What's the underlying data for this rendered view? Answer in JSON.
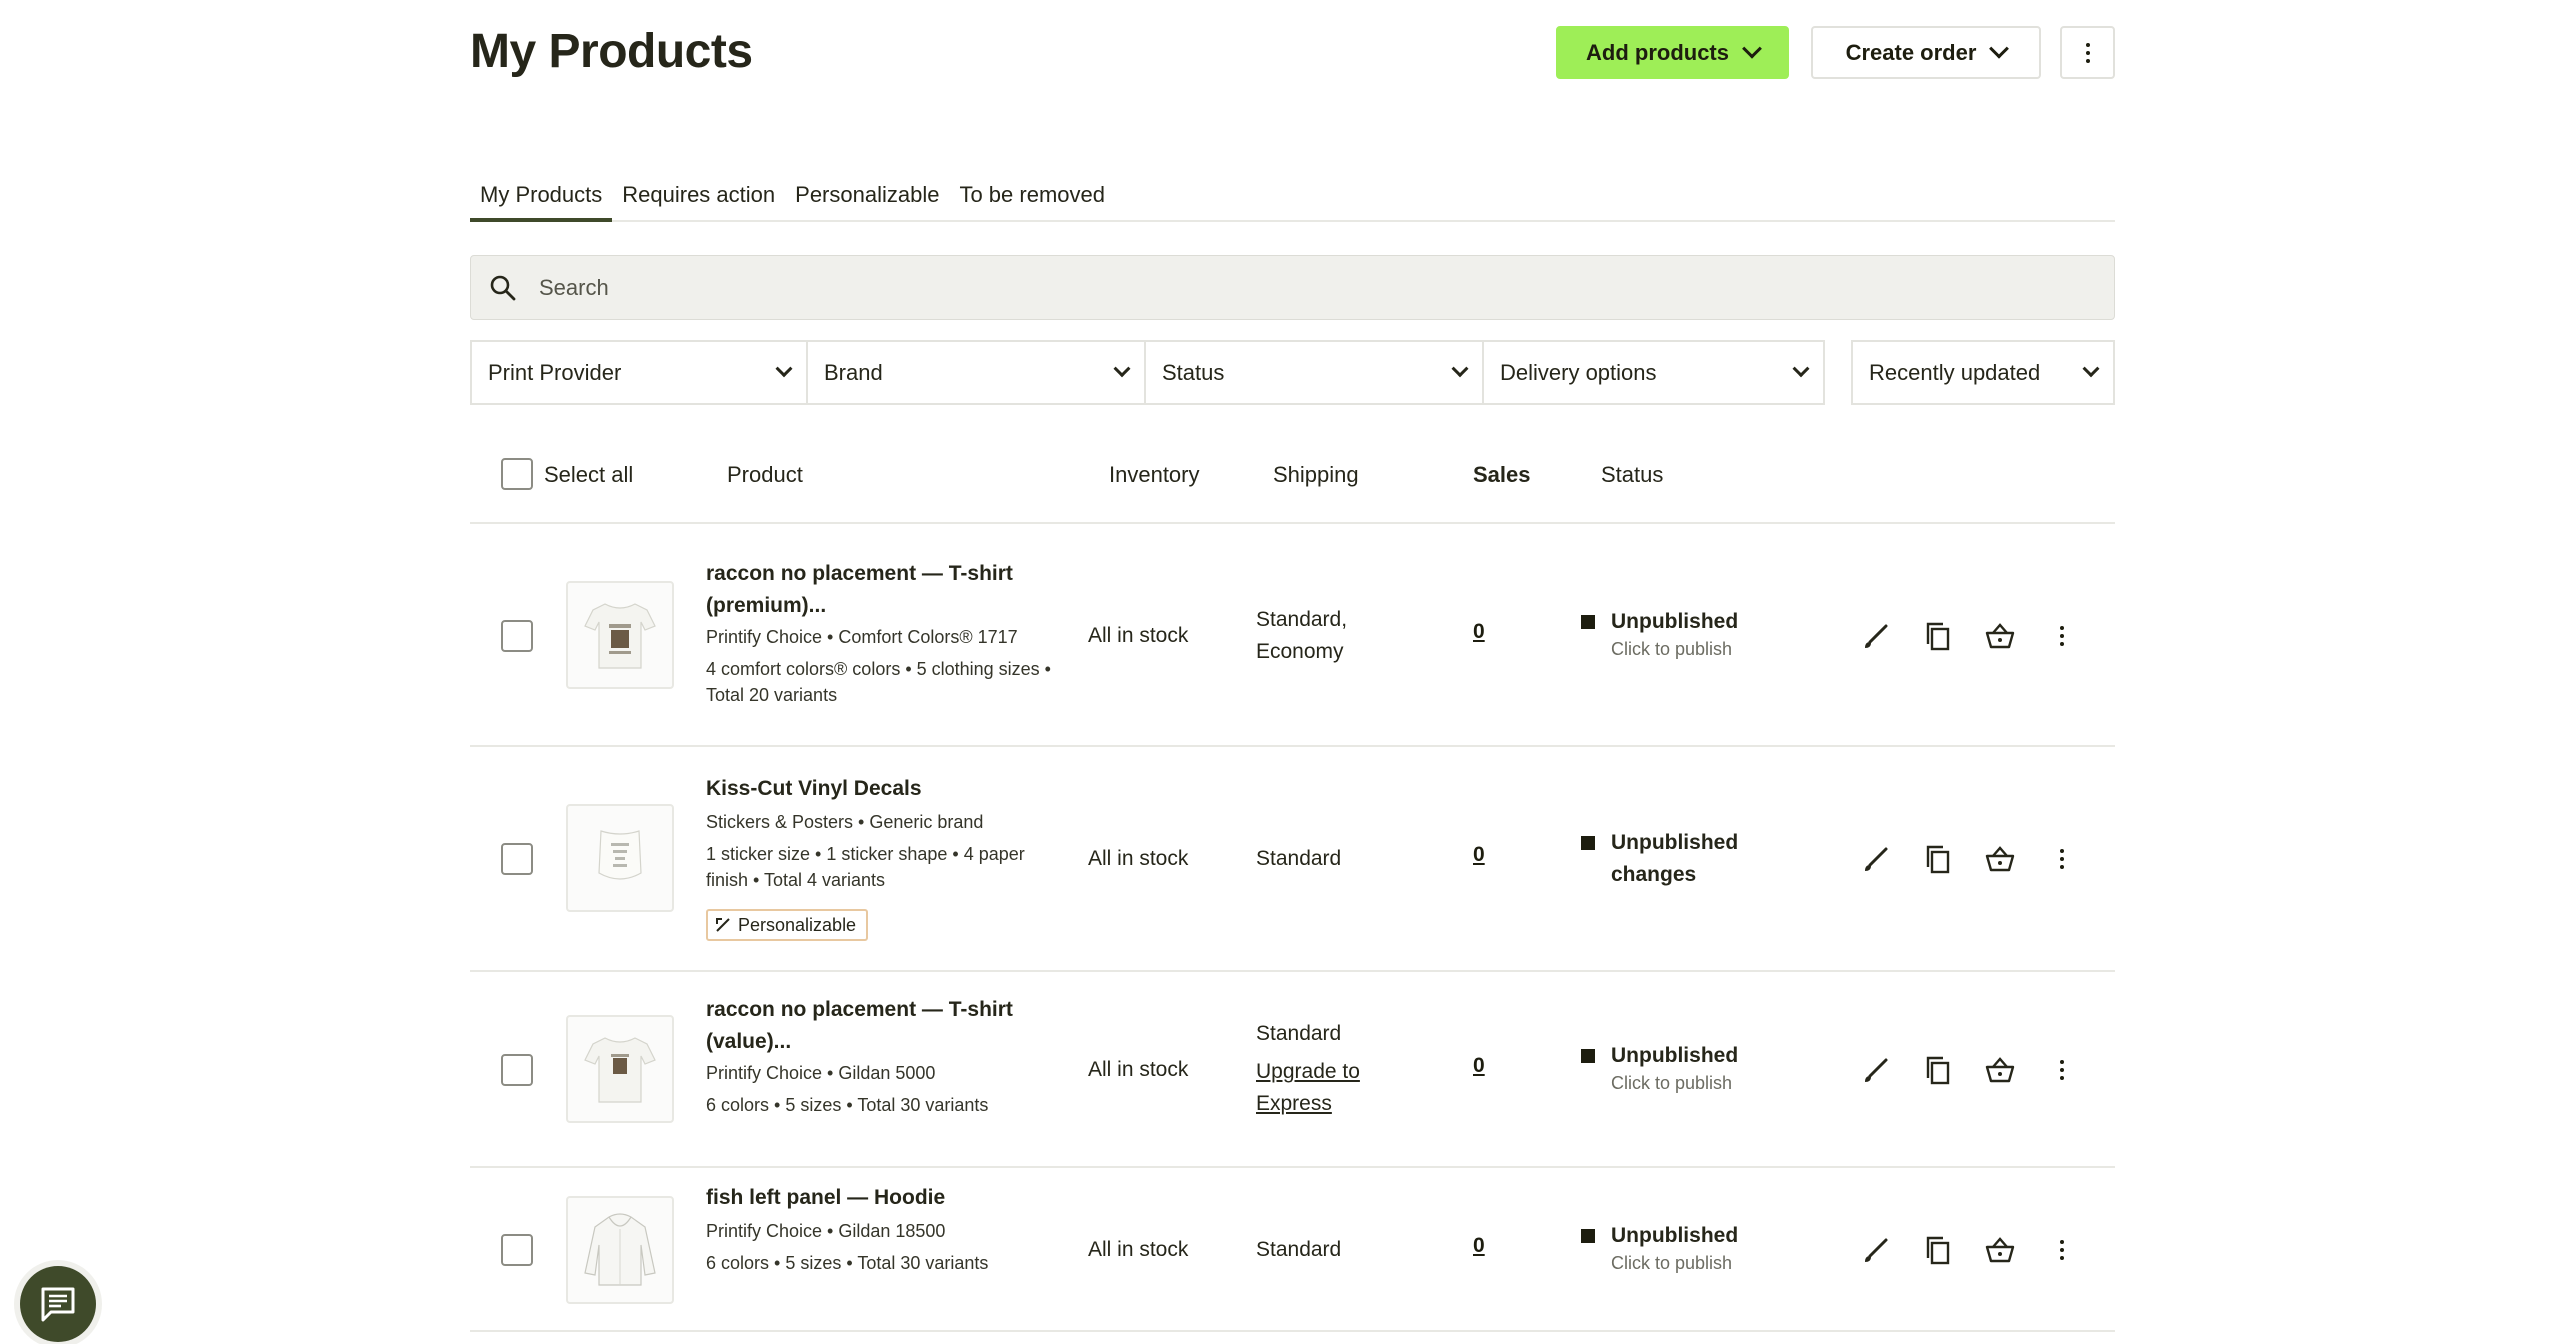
{
  "header": {
    "title": "My Products",
    "add_products_label": "Add products",
    "create_order_label": "Create order"
  },
  "tabs": [
    {
      "label": "My Products",
      "active": true
    },
    {
      "label": "Requires action"
    },
    {
      "label": "Personalizable"
    },
    {
      "label": "To be removed"
    }
  ],
  "search": {
    "placeholder": "Search"
  },
  "filters": {
    "print_provider": "Print Provider",
    "brand": "Brand",
    "status": "Status",
    "delivery": "Delivery options",
    "sort": "Recently updated"
  },
  "table": {
    "select_all": "Select all",
    "columns": {
      "product": "Product",
      "inventory": "Inventory",
      "shipping": "Shipping",
      "sales": "Sales",
      "status": "Status"
    }
  },
  "rows": [
    {
      "name": "raccon no placement — T-shirt (premium)...",
      "provider": "Printify Choice • Comfort Colors® 1717",
      "variants": "4 comfort colors® colors • 5 clothing sizes • Total 20 variants",
      "inventory": "All in stock",
      "shipping": "Standard, Economy",
      "sales": "0",
      "status": "Unpublished",
      "status_sub": "Click to publish"
    },
    {
      "name": "Kiss-Cut Vinyl Decals",
      "provider": "Stickers & Posters • Generic brand",
      "variants": "1 sticker size • 1 sticker shape • 4 paper finish • Total 4 variants",
      "badge": "Personalizable",
      "inventory": "All in stock",
      "shipping": "Standard",
      "sales": "0",
      "status": "Unpublished changes"
    },
    {
      "name": "raccon no placement — T-shirt (value)...",
      "provider": "Printify Choice • Gildan 5000",
      "variants": "6 colors • 5 sizes • Total 30 variants",
      "inventory": "All in stock",
      "shipping": "Standard",
      "shipping_link": "Upgrade to Express",
      "sales": "0",
      "status": "Unpublished",
      "status_sub": "Click to publish"
    },
    {
      "name": "fish left panel — Hoodie",
      "provider": "Printify Choice • Gildan 18500",
      "variants": "6 colors • 5 sizes • Total 30 variants",
      "inventory": "All in stock",
      "shipping": "Standard",
      "sales": "0",
      "status": "Unpublished",
      "status_sub": "Click to publish"
    }
  ],
  "colors": {
    "primary_button": "#9eee57",
    "text": "#26261a",
    "chat_bubble": "#3f4a2a"
  }
}
